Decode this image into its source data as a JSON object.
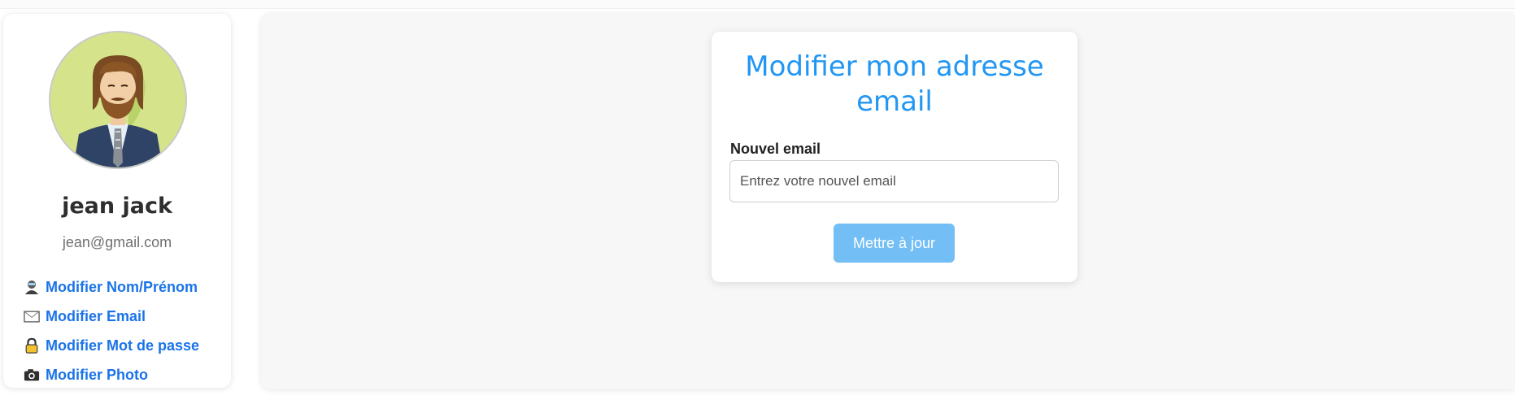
{
  "profile": {
    "name": "jean jack",
    "email": "jean@gmail.com"
  },
  "sidebar": {
    "items": [
      {
        "label": "Modifier Nom/Prénom",
        "icon": "person-icon"
      },
      {
        "label": "Modifier Email",
        "icon": "envelope-icon"
      },
      {
        "label": "Modifier Mot de passe",
        "icon": "lock-icon"
      },
      {
        "label": "Modifier Photo",
        "icon": "camera-icon"
      }
    ]
  },
  "form": {
    "title": "Modifier mon adresse email",
    "field_label": "Nouvel email",
    "email_value": "",
    "email_placeholder": "Entrez votre nouvel email",
    "submit_label": "Mettre à jour"
  },
  "colors": {
    "link": "#1a73e8",
    "title": "#2196f3",
    "button": "#73bef5",
    "avatar_bg": "#d5e48a"
  }
}
